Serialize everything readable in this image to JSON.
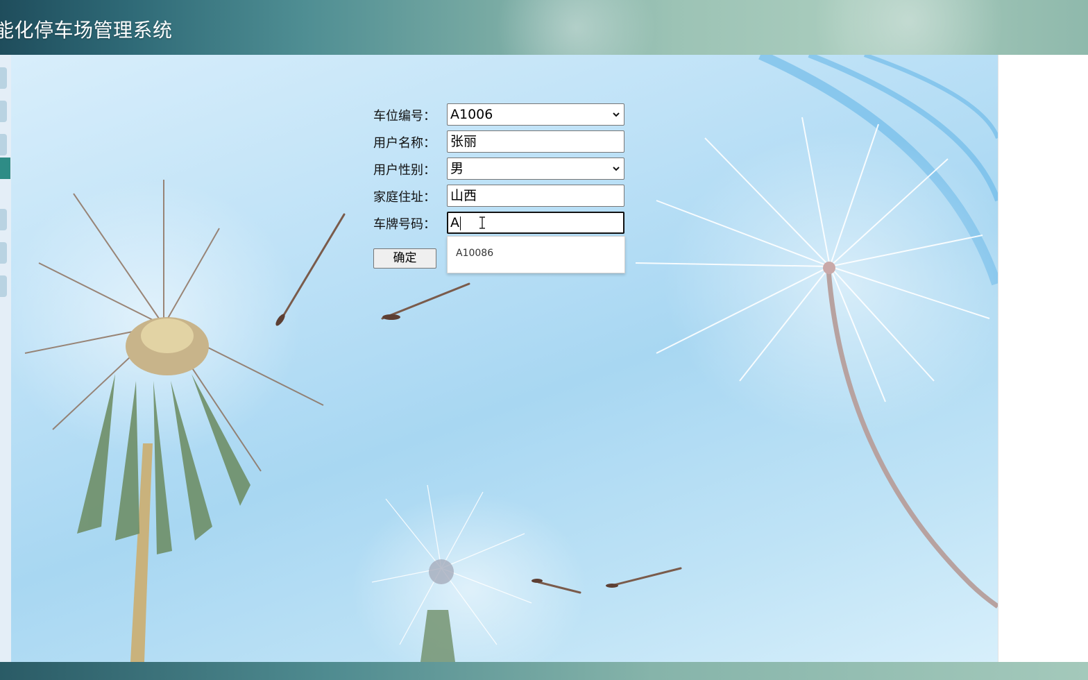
{
  "header": {
    "title": "能化停车场管理系统"
  },
  "sidebar": {
    "tab_count": 7,
    "active_index": 3
  },
  "form": {
    "fields": [
      {
        "label": "车位编号：",
        "value": "A1006",
        "type": "select"
      },
      {
        "label": "用户名称：",
        "value": "张丽",
        "type": "text"
      },
      {
        "label": "用户性别：",
        "value": "男",
        "type": "select"
      },
      {
        "label": "家庭住址：",
        "value": "山西",
        "type": "text"
      },
      {
        "label": "车牌号码：",
        "value": "A",
        "type": "text"
      }
    ],
    "confirm_label": "确定",
    "autocomplete": {
      "options": [
        "A10086"
      ]
    }
  },
  "colors": {
    "header_dark": "#1f4d5c",
    "header_light": "#a9ccbd",
    "sidebar_active": "#2e8c86",
    "sky": "#a8d7f2"
  },
  "icons": {
    "select_arrow": "chevron-down-icon",
    "text_cursor": "ibeam-cursor-icon"
  }
}
